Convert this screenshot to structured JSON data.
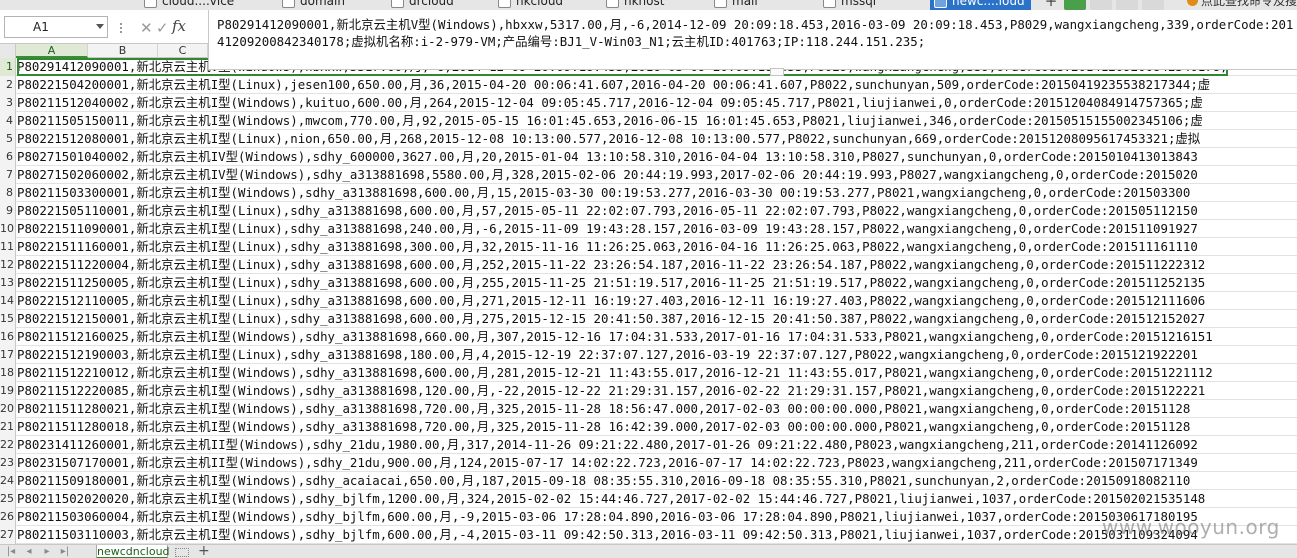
{
  "tabs": [
    {
      "label": "cloud....vice",
      "active": false
    },
    {
      "label": "domain",
      "active": false
    },
    {
      "label": "drcloud",
      "active": false
    },
    {
      "label": "hkcloud",
      "active": false
    },
    {
      "label": "hkhost",
      "active": false
    },
    {
      "label": "mail",
      "active": false
    },
    {
      "label": "mssql",
      "active": false
    },
    {
      "label": "newc....loud",
      "active": true
    }
  ],
  "extension_text": "点此查找命令及搜",
  "formula_bar": {
    "cell_ref": "A1",
    "fx": "fx",
    "content": "P80291412090001,新北京云主机V型(Windows),hbxxw,5317.00,月,-6,2014-12-09 20:09:18.453,2016-03-09 20:09:18.453,P8029,wangxiangcheng,339,orderCode:20141209200842340178;虚拟机名称:i-2-979-VM;产品编号:BJ1_V-Win03_N1;云主机ID:401763;IP:118.244.151.235;"
  },
  "columns": [
    "A",
    "B",
    "C"
  ],
  "rows": [
    {
      "num": "1",
      "text": "P80291412090001,新北京云主机V型(Windows),hbxxw,5317.00,月,-6,2014-12-09 20:09:18.453,2016-03-09 20:09:18.453,P8029,wangxiangcheng,339,orderCode:20141209200842340178;"
    },
    {
      "num": "2",
      "text": "P80221504200001,新北京云主机I型(Linux),jesen100,650.00,月,36,2015-04-20 00:06:41.607,2016-04-20 00:06:41.607,P8022,sunchunyan,509,orderCode:20150419235538217344;虚"
    },
    {
      "num": "3",
      "text": "P80211512040002,新北京云主机I型(Windows),kuituo,600.00,月,264,2015-12-04 09:05:45.717,2016-12-04 09:05:45.717,P8021,liujianwei,0,orderCode:20151204084914757365;虚"
    },
    {
      "num": "4",
      "text": "P80211505150011,新北京云主机I型(Windows),mwcom,770.00,月,92,2015-05-15 16:01:45.653,2016-06-15 16:01:45.653,P8021,liujianwei,346,orderCode:20150515155002345106;虚"
    },
    {
      "num": "5",
      "text": "P80221512080001,新北京云主机I型(Linux),nion,650.00,月,268,2015-12-08 10:13:00.577,2016-12-08 10:13:00.577,P8022,sunchunyan,669,orderCode:20151208095617453321;虚拟"
    },
    {
      "num": "6",
      "text": "P80271501040002,新北京云主机IV型(Windows),sdhy_600000,3627.00,月,20,2015-01-04 13:10:58.310,2016-04-04 13:10:58.310,P8027,sunchunyan,0,orderCode:2015010413013843"
    },
    {
      "num": "7",
      "text": "P80271502060002,新北京云主机IV型(Windows),sdhy_a313881698,5580.00,月,328,2015-02-06 20:44:19.993,2017-02-06 20:44:19.993,P8027,wangxiangcheng,0,orderCode:2015020"
    },
    {
      "num": "8",
      "text": "P80211503300001,新北京云主机I型(Windows),sdhy_a313881698,600.00,月,15,2015-03-30 00:19:53.277,2016-03-30 00:19:53.277,P8021,wangxiangcheng,0,orderCode:201503300"
    },
    {
      "num": "9",
      "text": "P80221505110001,新北京云主机I型(Linux),sdhy_a313881698,600.00,月,57,2015-05-11 22:02:07.793,2016-05-11 22:02:07.793,P8022,wangxiangcheng,0,orderCode:201505112150"
    },
    {
      "num": "10",
      "text": "P80221511090001,新北京云主机I型(Linux),sdhy_a313881698,240.00,月,-6,2015-11-09 19:43:28.157,2016-03-09 19:43:28.157,P8022,wangxiangcheng,0,orderCode:201511091927"
    },
    {
      "num": "11",
      "text": "P80221511160001,新北京云主机I型(Linux),sdhy_a313881698,300.00,月,32,2015-11-16 11:26:25.063,2016-04-16 11:26:25.063,P8022,wangxiangcheng,0,orderCode:201511161110"
    },
    {
      "num": "12",
      "text": "P80221511220004,新北京云主机I型(Linux),sdhy_a313881698,600.00,月,252,2015-11-22 23:26:54.187,2016-11-22 23:26:54.187,P8022,wangxiangcheng,0,orderCode:201511222312"
    },
    {
      "num": "13",
      "text": "P80221511250005,新北京云主机I型(Linux),sdhy_a313881698,600.00,月,255,2015-11-25 21:51:19.517,2016-11-25 21:51:19.517,P8022,wangxiangcheng,0,orderCode:201511252135"
    },
    {
      "num": "14",
      "text": "P80221512110005,新北京云主机I型(Linux),sdhy_a313881698,600.00,月,271,2015-12-11 16:19:27.403,2016-12-11 16:19:27.403,P8022,wangxiangcheng,0,orderCode:201512111606"
    },
    {
      "num": "15",
      "text": "P80221512150001,新北京云主机I型(Linux),sdhy_a313881698,600.00,月,275,2015-12-15 20:41:50.387,2016-12-15 20:41:50.387,P8022,wangxiangcheng,0,orderCode:201512152027"
    },
    {
      "num": "16",
      "text": "P80211512160025,新北京云主机I型(Windows),sdhy_a313881698,660.00,月,307,2015-12-16 17:04:31.533,2017-01-16 17:04:31.533,P8021,wangxiangcheng,0,orderCode:20151216151"
    },
    {
      "num": "17",
      "text": "P80221512190003,新北京云主机I型(Linux),sdhy_a313881698,180.00,月,4,2015-12-19 22:37:07.127,2016-03-19 22:37:07.127,P8022,wangxiangcheng,0,orderCode:2015121922201"
    },
    {
      "num": "18",
      "text": "P80211512210012,新北京云主机I型(Windows),sdhy_a313881698,600.00,月,281,2015-12-21 11:43:55.017,2016-12-21 11:43:55.017,P8021,wangxiangcheng,0,orderCode:20151221112"
    },
    {
      "num": "19",
      "text": "P80211512220085,新北京云主机I型(Windows),sdhy_a313881698,120.00,月,-22,2015-12-22 21:29:31.157,2016-02-22 21:29:31.157,P8021,wangxiangcheng,0,orderCode:2015122221"
    },
    {
      "num": "20",
      "text": "P80211511280021,新北京云主机I型(Windows),sdhy_a313881698,720.00,月,325,2015-11-28 18:56:47.000,2017-02-03 00:00:00.000,P8021,wangxiangcheng,0,orderCode:20151128"
    },
    {
      "num": "21",
      "text": "P80211511280018,新北京云主机I型(Windows),sdhy_a313881698,720.00,月,325,2015-11-28 16:42:39.000,2017-02-03 00:00:00.000,P8021,wangxiangcheng,0,orderCode:20151128"
    },
    {
      "num": "22",
      "text": "P80231411260001,新北京云主机II型(Windows),sdhy_21du,1980.00,月,317,2014-11-26 09:21:22.480,2017-01-26 09:21:22.480,P8023,wangxiangcheng,211,orderCode:20141126092"
    },
    {
      "num": "23",
      "text": "P80231507170001,新北京云主机II型(Windows),sdhy_21du,900.00,月,124,2015-07-17 14:02:22.723,2016-07-17 14:02:22.723,P8023,wangxiangcheng,211,orderCode:201507171349"
    },
    {
      "num": "24",
      "text": "P80211509180001,新北京云主机I型(Windows),sdhy_acaiacai,650.00,月,187,2015-09-18 08:35:55.310,2016-09-18 08:35:55.310,P8021,sunchunyan,2,orderCode:20150918082110"
    },
    {
      "num": "25",
      "text": "P80211502020020,新北京云主机I型(Windows),sdhy_bjlfm,1200.00,月,324,2015-02-02 15:44:46.727,2017-02-02 15:44:46.727,P8021,liujianwei,1037,orderCode:201502021535148"
    },
    {
      "num": "26",
      "text": "P80211503060004,新北京云主机I型(Windows),sdhy_bjlfm,600.00,月,-9,2015-03-06 17:28:04.890,2016-03-06 17:28:04.890,P8021,liujianwei,1037,orderCode:2015030617180195"
    },
    {
      "num": "27",
      "text": "P80211503110003,新北京云主机I型(Windows),sdhy_bjlfm,600.00,月,-4,2015-03-11 09:42:50.313,2016-03-11 09:42:50.313,P8021,liujianwei,1037,orderCode:2015031109324094"
    }
  ],
  "sheet_tab": "newcdncloud",
  "watermark": "www.wooyun.org"
}
